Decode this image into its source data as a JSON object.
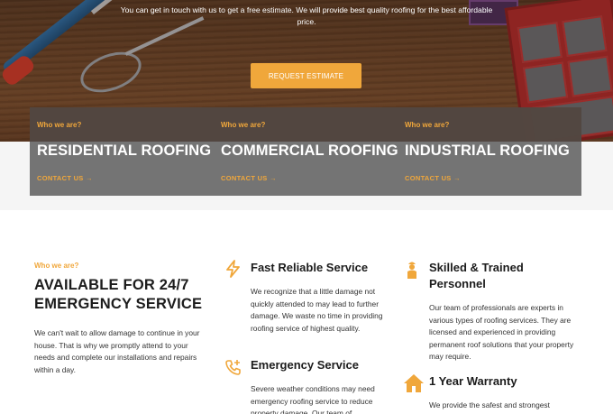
{
  "hero": {
    "subtitle": "You can get in touch with us to get a free estimate. We will provide best quality roofing for the best affordable price.",
    "button_label": "REQUEST ESTIMATE"
  },
  "services": [
    {
      "eyebrow": "Who we are?",
      "title": "RESIDENTIAL ROOFING",
      "link": "CONTACT US →"
    },
    {
      "eyebrow": "Who we are?",
      "title": "COMMERCIAL ROOFING",
      "link": "CONTACT US →"
    },
    {
      "eyebrow": "Who we are?",
      "title": "INDUSTRIAL ROOFING",
      "link": "CONTACT US →"
    }
  ],
  "about": {
    "eyebrow": "Who we are?",
    "heading": "AVAILABLE FOR 24/7 EMERGENCY SERVICE",
    "text": "We can't wait to allow damage to continue in your house. That is why we promptly attend to your needs and complete our installations and repairs within a day."
  },
  "features": [
    {
      "icon": "lightning-icon",
      "title": "Fast Reliable Service",
      "text": "We recognize that a little damage not quickly attended to may lead to further damage. We waste no time in providing roofing service of highest quality."
    },
    {
      "icon": "phone-plus-icon",
      "title": "Emergency Service",
      "text": "Severe weather conditions may need emergency roofing service to reduce property damage. Our team of"
    },
    {
      "icon": "worker-icon",
      "title": "Skilled & Trained Personnel",
      "text": "Our team of professionals are experts in various types of roofing services. They are licensed and experienced in providing permanent roof solutions that your property may require."
    },
    {
      "icon": "house-icon",
      "title": "1 Year Warranty",
      "text": "We provide the safest and strongest"
    }
  ],
  "colors": {
    "accent": "#f0a73b",
    "overlay": "#6e6e6e",
    "heading": "#1c1c1c"
  }
}
